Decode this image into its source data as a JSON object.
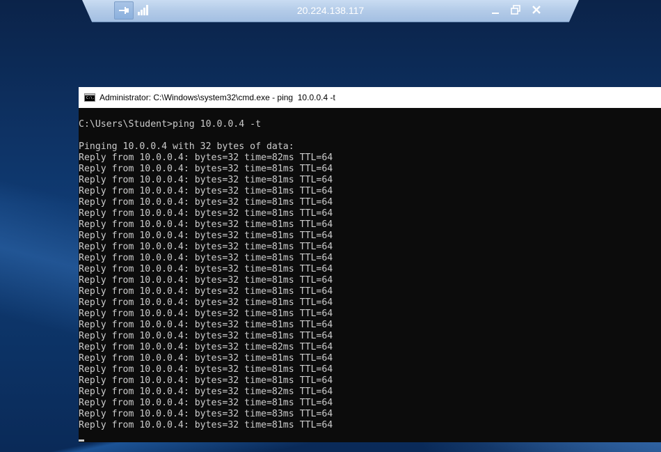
{
  "rdp": {
    "title": "20.224.138.117",
    "pin_icon": "pin-icon",
    "signal_icon": "signal-strength-icon",
    "minimize_icon": "minimize-icon",
    "restore_icon": "restore-icon",
    "close_icon": "close-icon"
  },
  "cmd": {
    "title": "Administrator: C:\\Windows\\system32\\cmd.exe - ping  10.0.0.4 -t",
    "icon_label": "C:\\.",
    "lines": [
      "C:\\Users\\Student>ping 10.0.0.4 -t",
      "",
      "Pinging 10.0.0.4 with 32 bytes of data:",
      "Reply from 10.0.0.4: bytes=32 time=82ms TTL=64",
      "Reply from 10.0.0.4: bytes=32 time=81ms TTL=64",
      "Reply from 10.0.0.4: bytes=32 time=81ms TTL=64",
      "Reply from 10.0.0.4: bytes=32 time=81ms TTL=64",
      "Reply from 10.0.0.4: bytes=32 time=81ms TTL=64",
      "Reply from 10.0.0.4: bytes=32 time=81ms TTL=64",
      "Reply from 10.0.0.4: bytes=32 time=81ms TTL=64",
      "Reply from 10.0.0.4: bytes=32 time=81ms TTL=64",
      "Reply from 10.0.0.4: bytes=32 time=81ms TTL=64",
      "Reply from 10.0.0.4: bytes=32 time=81ms TTL=64",
      "Reply from 10.0.0.4: bytes=32 time=81ms TTL=64",
      "Reply from 10.0.0.4: bytes=32 time=81ms TTL=64",
      "Reply from 10.0.0.4: bytes=32 time=81ms TTL=64",
      "Reply from 10.0.0.4: bytes=32 time=81ms TTL=64",
      "Reply from 10.0.0.4: bytes=32 time=81ms TTL=64",
      "Reply from 10.0.0.4: bytes=32 time=81ms TTL=64",
      "Reply from 10.0.0.4: bytes=32 time=81ms TTL=64",
      "Reply from 10.0.0.4: bytes=32 time=82ms TTL=64",
      "Reply from 10.0.0.4: bytes=32 time=81ms TTL=64",
      "Reply from 10.0.0.4: bytes=32 time=81ms TTL=64",
      "Reply from 10.0.0.4: bytes=32 time=81ms TTL=64",
      "Reply from 10.0.0.4: bytes=32 time=82ms TTL=64",
      "Reply from 10.0.0.4: bytes=32 time=81ms TTL=64",
      "Reply from 10.0.0.4: bytes=32 time=83ms TTL=64",
      "Reply from 10.0.0.4: bytes=32 time=81ms TTL=64"
    ]
  },
  "colors": {
    "console_bg": "#0c0c0c",
    "console_text": "#cccccc",
    "rdp_bar": "#b3cbe8"
  }
}
